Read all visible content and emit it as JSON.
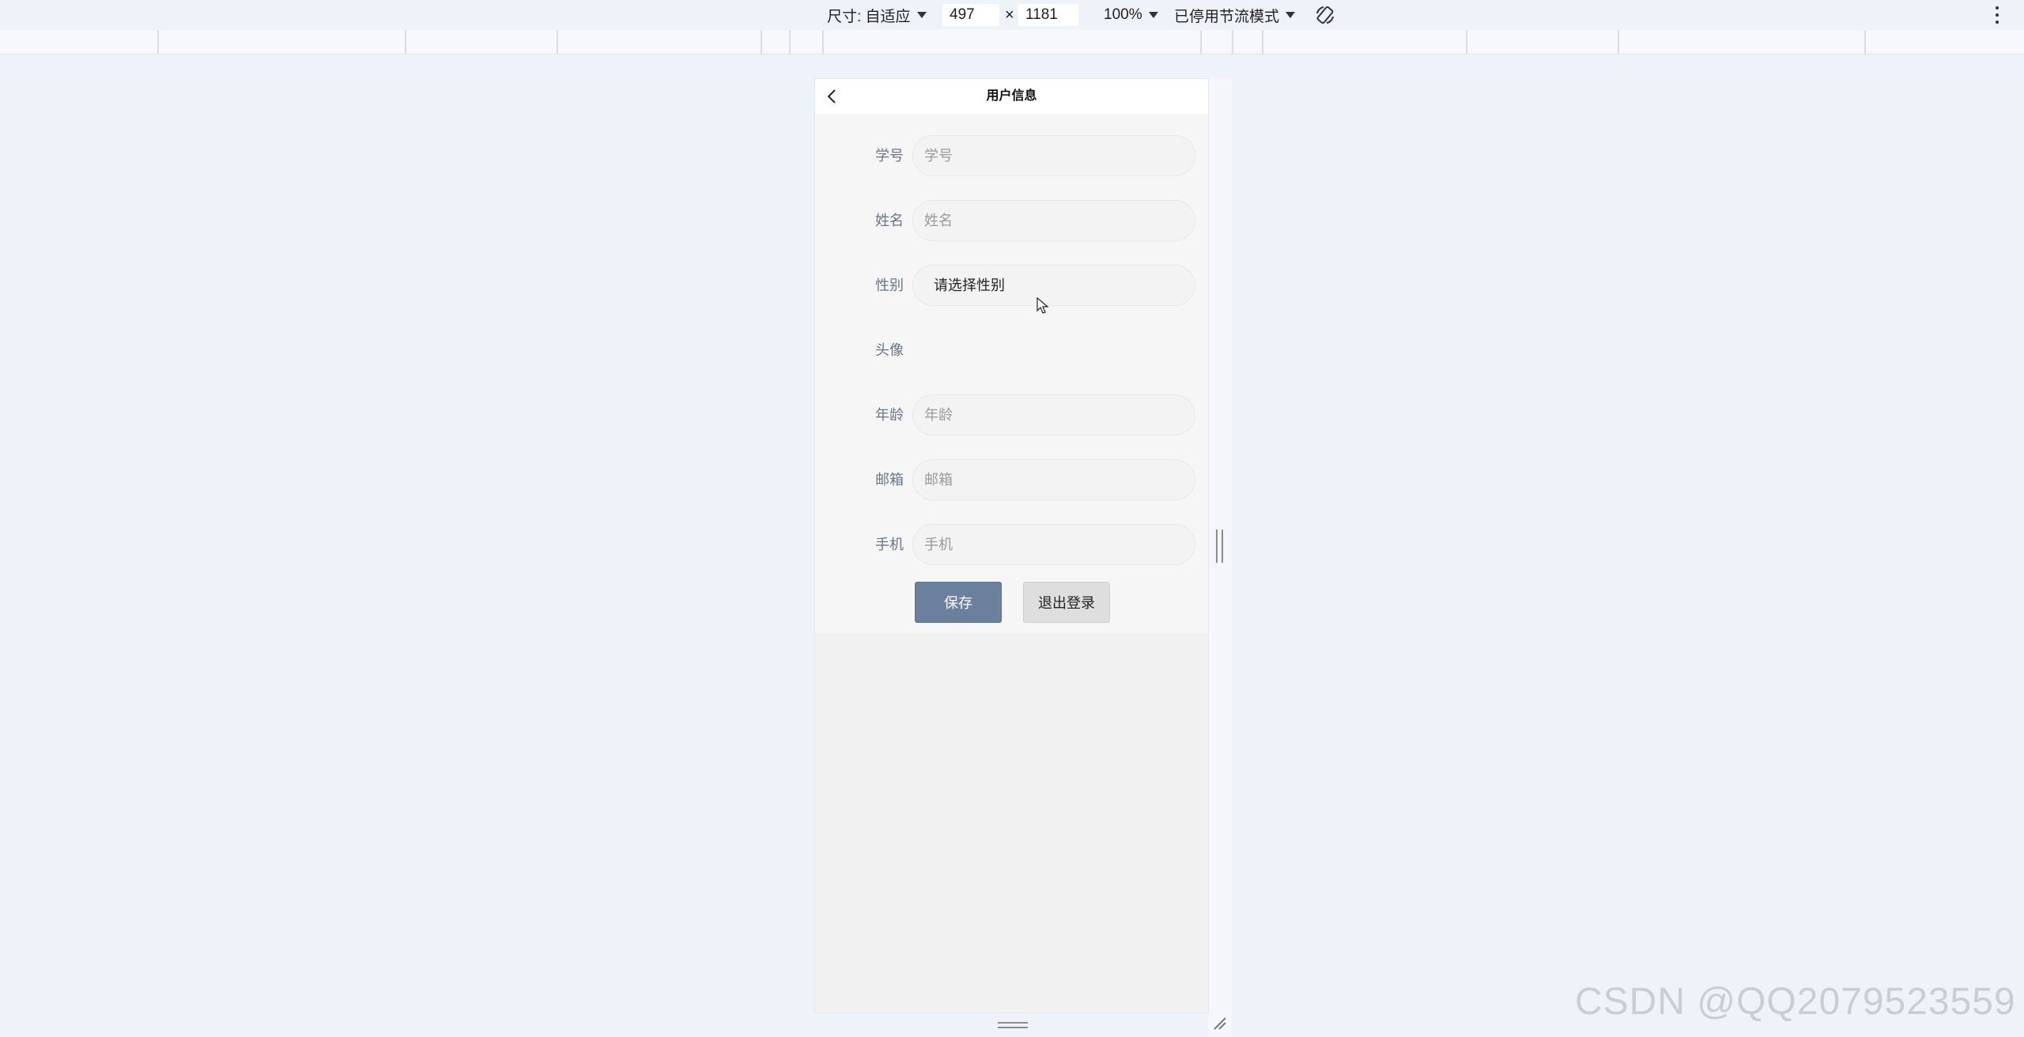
{
  "devtools": {
    "size_label": "尺寸: 自适应",
    "width_value": "497",
    "times_symbol": "×",
    "height_value": "1181",
    "zoom": "100%",
    "throttle": "已停用节流模式",
    "rotate_icon": "rotate-icon",
    "more_icon": "kebab-menu-icon"
  },
  "page": {
    "title": "用户信息",
    "back_icon": "chevron-left-icon",
    "fields": [
      {
        "label": "学号",
        "placeholder": "学号",
        "value": ""
      },
      {
        "label": "姓名",
        "placeholder": "姓名",
        "value": ""
      },
      {
        "label": "性别",
        "select_text": "请选择性别"
      },
      {
        "label": "头像"
      },
      {
        "label": "年龄",
        "placeholder": "年龄",
        "value": ""
      },
      {
        "label": "邮箱",
        "placeholder": "邮箱",
        "value": ""
      },
      {
        "label": "手机",
        "placeholder": "手机",
        "value": ""
      }
    ],
    "buttons": {
      "save": "保存",
      "logout": "退出登录"
    }
  },
  "colors": {
    "save_button": "#6a809d",
    "logout_button": "#dedede",
    "label_text": "#6a7588",
    "background": "#eef2f9"
  },
  "watermark": "CSDN @QQ2079523559"
}
